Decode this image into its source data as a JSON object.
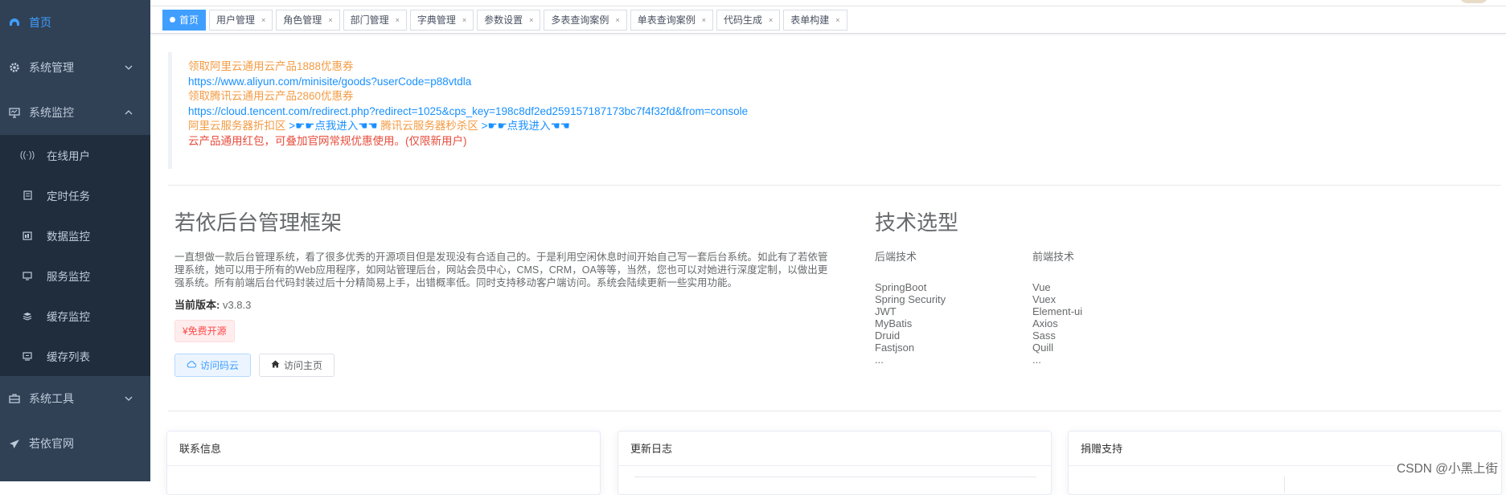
{
  "sidebar": {
    "home": "首页",
    "system": "系统管理",
    "monitor": "系统监控",
    "sub": [
      {
        "label": "在线用户",
        "icon": "online-icon"
      },
      {
        "label": "定时任务",
        "icon": "job-icon"
      },
      {
        "label": "数据监控",
        "icon": "druid-icon"
      },
      {
        "label": "服务监控",
        "icon": "server-icon"
      },
      {
        "label": "缓存监控",
        "icon": "redis-icon"
      },
      {
        "label": "缓存列表",
        "icon": "cache-list-icon"
      }
    ],
    "tool": "系统工具",
    "site": "若依官网"
  },
  "tabs": [
    {
      "label": "首页",
      "active": true
    },
    {
      "label": "用户管理"
    },
    {
      "label": "角色管理"
    },
    {
      "label": "部门管理"
    },
    {
      "label": "字典管理"
    },
    {
      "label": "参数设置"
    },
    {
      "label": "多表查询案例"
    },
    {
      "label": "单表查询案例"
    },
    {
      "label": "代码生成"
    },
    {
      "label": "表单构建"
    }
  ],
  "tab_close": "×",
  "notice": {
    "aliyun_title": "领取阿里云通用云产品1888优惠券",
    "aliyun_url": "https://www.aliyun.com/minisite/goods?userCode=p88vtdla",
    "tencent_title": "领取腾讯云通用云产品2860优惠券",
    "tencent_url": "https://cloud.tencent.com/redirect.php?redirect=1025&cps_key=198c8df2ed259157187173bc7f4f32fd&from=console",
    "aliyun_zone": "阿里云服务器折扣区",
    "enter_link": ">☛☛点我进入☚☚",
    "tencent_zone": "腾讯云服务器秒杀区",
    "enter_link2": ">☛☛点我进入☚☚",
    "redpacket": "云产品通用红包，可叠加官网常规优惠使用。(仅限新用户)"
  },
  "intro": {
    "title": "若依后台管理框架",
    "desc": "一直想做一款后台管理系统，看了很多优秀的开源项目但是发现没有合适自己的。于是利用空闲休息时间开始自己写一套后台系统。如此有了若依管理系统，她可以用于所有的Web应用程序，如网站管理后台，网站会员中心，CMS，CRM，OA等等，当然，您也可以对她进行深度定制，以做出更强系统。所有前端后台代码封装过后十分精简易上手，出错概率低。同时支持移动客户端访问。系统会陆续更新一些实用功能。",
    "version_label": "当前版本:",
    "version": "v3.8.3",
    "free": "¥免费开源",
    "btn_gitee": "访问码云",
    "btn_home": "访问主页"
  },
  "tech": {
    "title": "技术选型",
    "backend_title": "后端技术",
    "backend": [
      "SpringBoot",
      "Spring Security",
      "JWT",
      "MyBatis",
      "Druid",
      "Fastjson",
      "..."
    ],
    "frontend_title": "前端技术",
    "frontend": [
      "Vue",
      "Vuex",
      "Element-ui",
      "Axios",
      "Sass",
      "Quill",
      "..."
    ]
  },
  "cards": {
    "contact": "联系信息",
    "changelog": "更新日志",
    "donate": "捐赠支持"
  },
  "watermark": "CSDN @小黑上街",
  "colors": {
    "sidebar_bg": "#304156",
    "submenu_bg": "#1f2d3d",
    "accent": "#409eff",
    "orange": "#f39c45",
    "red": "#e74c3c"
  }
}
